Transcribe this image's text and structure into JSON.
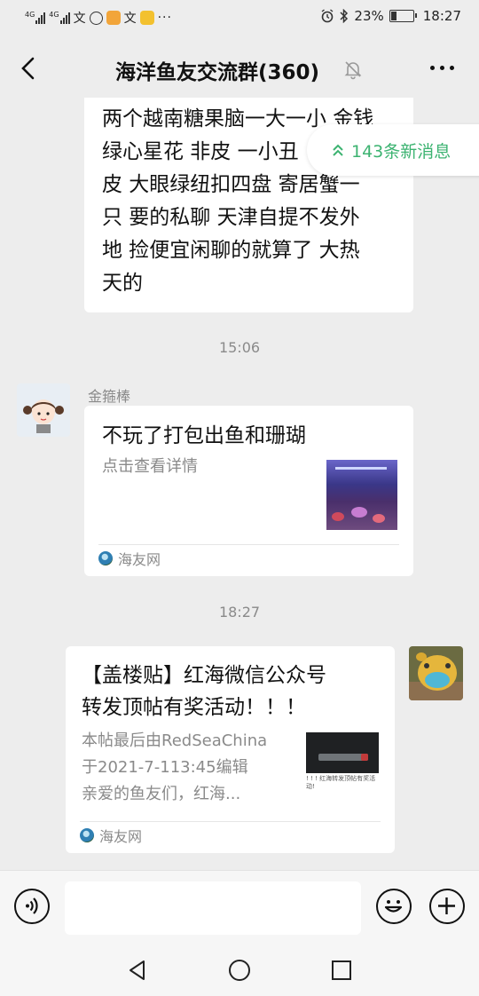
{
  "status_bar": {
    "net1": "4G",
    "net2": "4G",
    "battery_pct": "23%",
    "time": "18:27",
    "battery_level": 0.23,
    "icons": [
      "signal-icon",
      "signal-icon",
      "translate-icon",
      "shield-app-icon",
      "weather-app-icon",
      "translate-icon",
      "mail-app-icon",
      "more-dots-icon",
      "alarm-icon",
      "bluetooth-icon",
      "battery-icon"
    ]
  },
  "header": {
    "title": "海洋鱼友交流群(360)",
    "icons": [
      "back-icon",
      "mute-bell-icon",
      "more-icon"
    ]
  },
  "new_messages_badge": "143条新消息",
  "messages": [
    {
      "type": "text",
      "lines": [
        "两个越南糖果脑一大一小 金钱",
        "绿心星花 非皮 一小丑 ",
        "皮 大眼绿纽扣四盘 寄居蟹一",
        "只 要的私聊 天津自提不发外",
        "地 捡便宜闲聊的就算了 大热",
        "天的"
      ]
    },
    {
      "type": "time",
      "text": "15:06"
    },
    {
      "type": "link",
      "sender": "金箍棒",
      "title": "不玩了打包出鱼和珊瑚",
      "desc": "点击查看详情",
      "source": "海友网"
    },
    {
      "type": "time",
      "text": "18:27"
    },
    {
      "type": "link",
      "sender": "self",
      "title_lines": [
        "【盖楼贴】红海微信公众号",
        "转发顶帖有奖活动！！！"
      ],
      "desc_lines": [
        "本帖最后由RedSeaChina",
        "于2021-7-113:45编辑",
        "亲爱的鱼友们，红海..."
      ],
      "thumb_text": "! ! ! 红海转发顶帖有奖活动!",
      "source": "海友网"
    }
  ],
  "input_bar": {
    "value": "",
    "icons": [
      "voice-icon",
      "emoji-icon",
      "plus-icon"
    ]
  },
  "nav_bar": {
    "icons": [
      "nav-back-icon",
      "nav-home-icon",
      "nav-recents-icon"
    ]
  }
}
